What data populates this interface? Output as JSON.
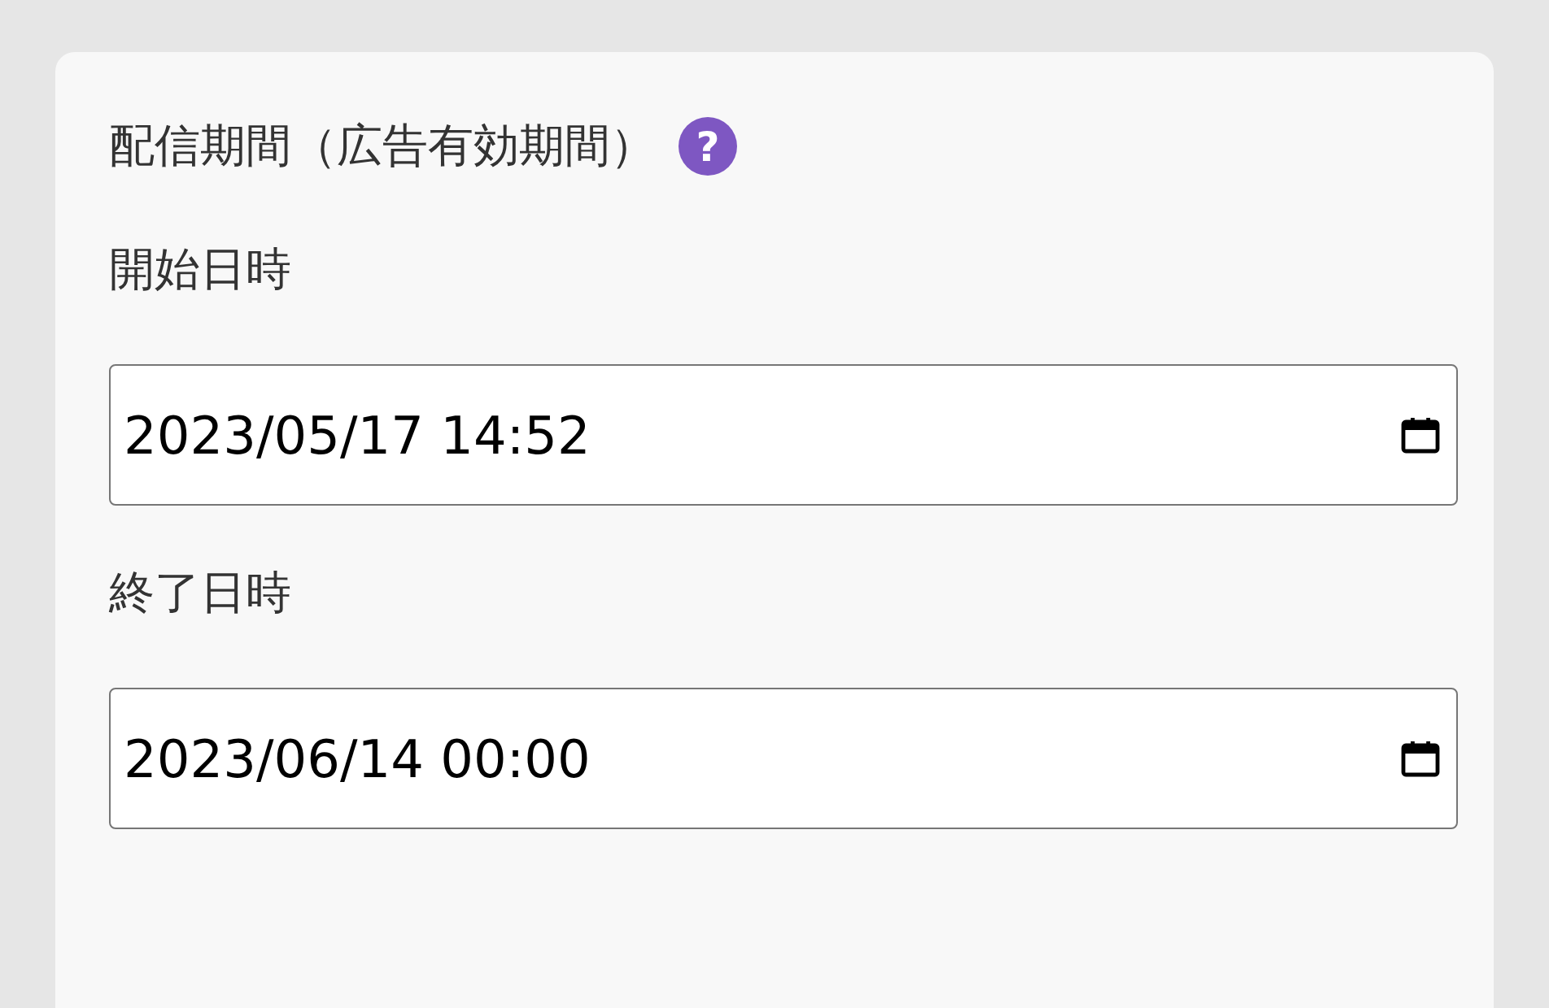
{
  "section": {
    "title": "配信期間（広告有効期間）",
    "help_icon": "?",
    "fields": [
      {
        "label": "開始日時",
        "value": "2023/05/17 14:52"
      },
      {
        "label": "終了日時",
        "value": "2023/06/14 00:00"
      }
    ]
  }
}
